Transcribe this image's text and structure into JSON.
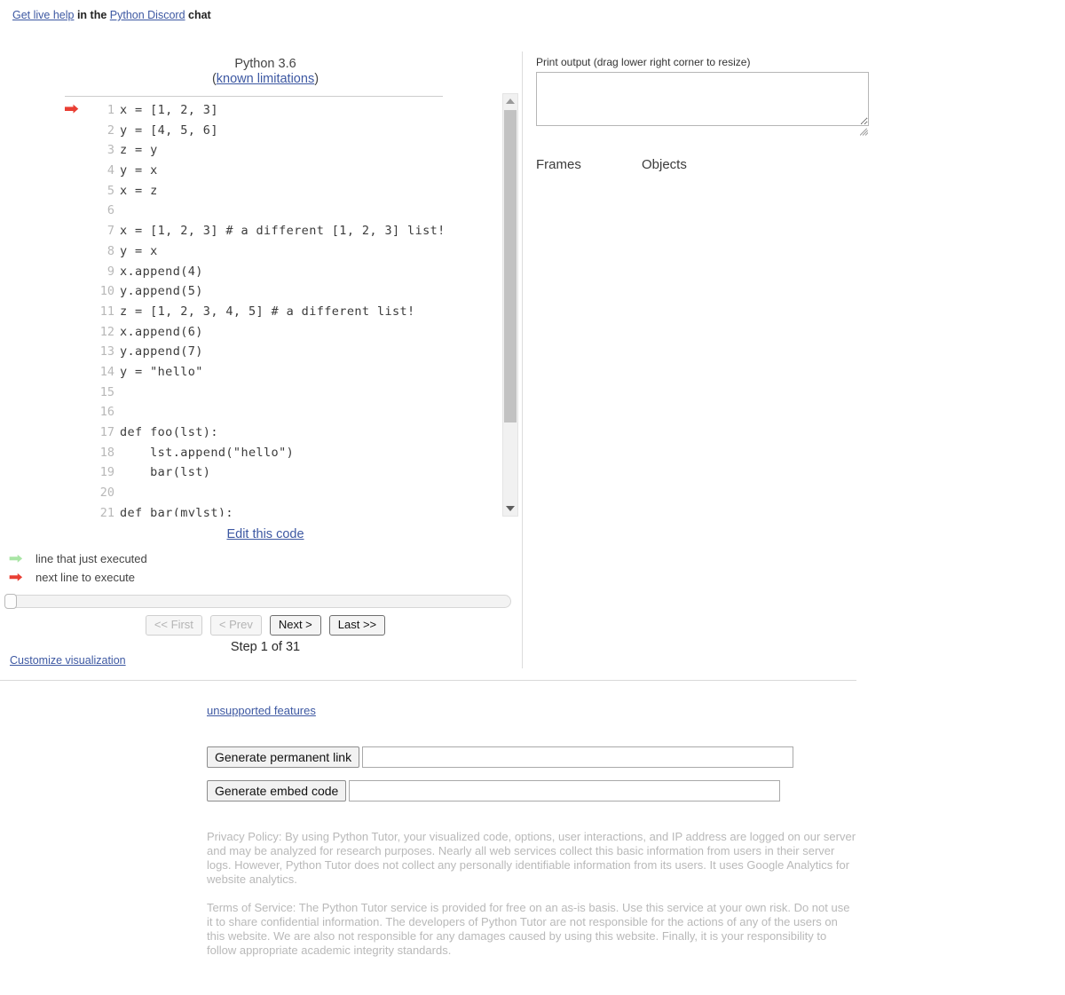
{
  "help_bar": {
    "link1": "Get live help",
    "mid": " in the ",
    "link2": "Python Discord",
    "tail": " chat"
  },
  "code_panel": {
    "version": "Python 3.6",
    "limitations_prefix": "(",
    "limitations_link": "known limitations",
    "limitations_suffix": ")",
    "edit_link": "Edit this code",
    "lines": [
      {
        "num": "1",
        "text": "x = [1, 2, 3]",
        "arrow": "next"
      },
      {
        "num": "2",
        "text": "y = [4, 5, 6]",
        "arrow": ""
      },
      {
        "num": "3",
        "text": "z = y",
        "arrow": ""
      },
      {
        "num": "4",
        "text": "y = x",
        "arrow": ""
      },
      {
        "num": "5",
        "text": "x = z",
        "arrow": ""
      },
      {
        "num": "6",
        "text": "",
        "arrow": ""
      },
      {
        "num": "7",
        "text": "x = [1, 2, 3] # a different [1, 2, 3] list!",
        "arrow": ""
      },
      {
        "num": "8",
        "text": "y = x",
        "arrow": ""
      },
      {
        "num": "9",
        "text": "x.append(4)",
        "arrow": ""
      },
      {
        "num": "10",
        "text": "y.append(5)",
        "arrow": ""
      },
      {
        "num": "11",
        "text": "z = [1, 2, 3, 4, 5] # a different list!",
        "arrow": ""
      },
      {
        "num": "12",
        "text": "x.append(6)",
        "arrow": ""
      },
      {
        "num": "13",
        "text": "y.append(7)",
        "arrow": ""
      },
      {
        "num": "14",
        "text": "y = \"hello\"",
        "arrow": ""
      },
      {
        "num": "15",
        "text": "",
        "arrow": ""
      },
      {
        "num": "16",
        "text": "",
        "arrow": ""
      },
      {
        "num": "17",
        "text": "def foo(lst):",
        "arrow": ""
      },
      {
        "num": "18",
        "text": "    lst.append(\"hello\")",
        "arrow": ""
      },
      {
        "num": "19",
        "text": "    bar(lst)",
        "arrow": ""
      },
      {
        "num": "20",
        "text": "",
        "arrow": ""
      },
      {
        "num": "21",
        "text": "def bar(mylst):",
        "arrow": ""
      }
    ]
  },
  "legend": {
    "just_executed": "line that just executed",
    "next_line": "next line to execute",
    "arrow_glyph": "➡"
  },
  "controls": {
    "first": "<< First",
    "prev": "< Prev",
    "next": "Next >",
    "last": "Last >>",
    "step_label": "Step 1 of 31",
    "current_step": 1,
    "total_steps": 31,
    "first_enabled": false,
    "prev_enabled": false,
    "next_enabled": true,
    "last_enabled": true,
    "customize_link": "Customize visualization"
  },
  "right_panel": {
    "print_output_label": "Print output (drag lower right corner to resize)",
    "print_output_value": "",
    "frames_label": "Frames",
    "objects_label": "Objects"
  },
  "bottom": {
    "unsupported_link": "unsupported features",
    "generate_permalink_button": "Generate permanent link",
    "permalink_value": "",
    "generate_embed_button": "Generate embed code",
    "embed_value": ""
  },
  "footer": {
    "privacy": "Privacy Policy: By using Python Tutor, your visualized code, options, user interactions, and IP address are logged on our server and may be analyzed for research purposes. Nearly all web services collect this basic information from users in their server logs. However, Python Tutor does not collect any personally identifiable information from its users. It uses Google Analytics for website analytics.",
    "terms": "Terms of Service: The Python Tutor service is provided for free on an as-is basis. Use this service at your own risk. Do not use it to share confidential information. The developers of Python Tutor are not responsible for the actions of any of the users on this website. We are also not responsible for any damages caused by using this website. Finally, it is your responsibility to follow appropriate academic integrity standards."
  },
  "colors": {
    "link": "#3d58a2",
    "next_arrow": "#e93f34",
    "just_arrow": "#a9e5a5",
    "code_text": "#3b3b3b",
    "lineno": "#b8b8b8",
    "footer_text": "#b9b9b9"
  }
}
